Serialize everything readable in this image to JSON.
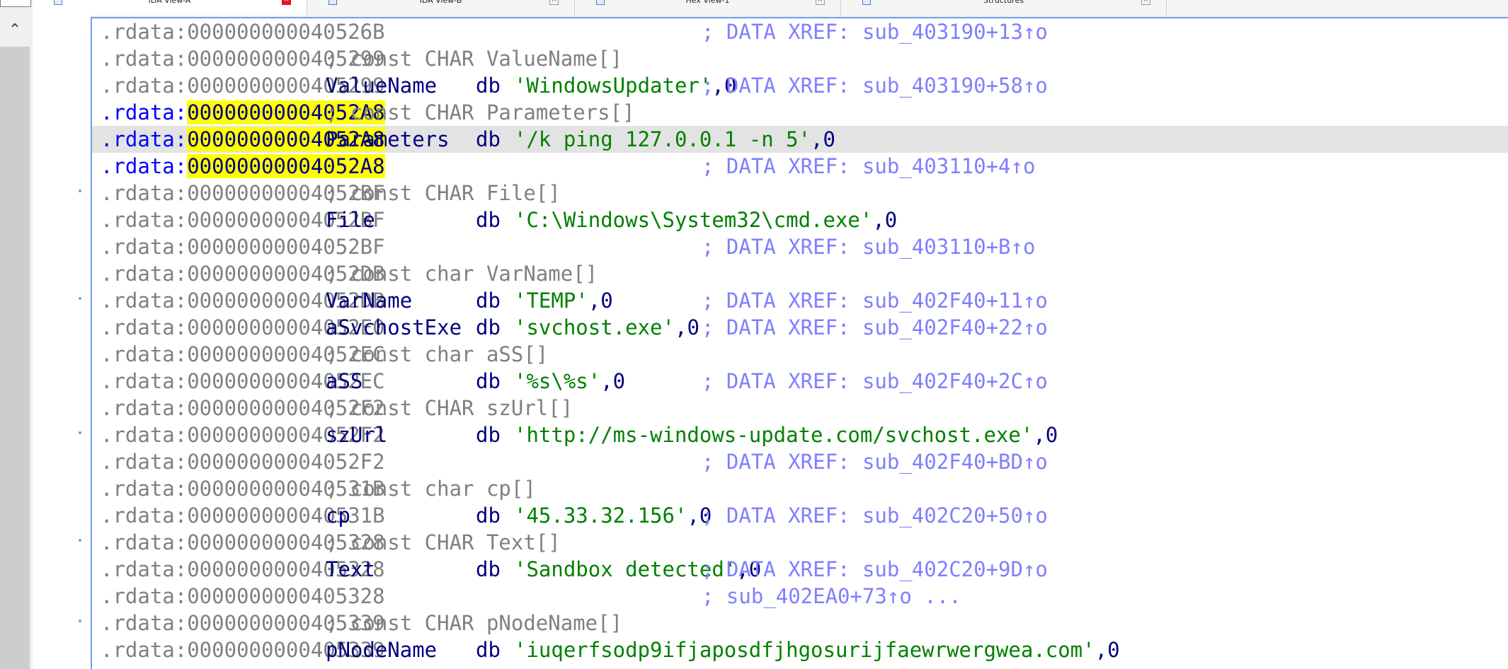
{
  "tabs": [
    {
      "label": "IDA View-A",
      "active": true,
      "icon": "ida-view-icon"
    },
    {
      "label": "IDA View-B",
      "active": false,
      "icon": "ida-view-icon"
    },
    {
      "label": "Hex View-1",
      "active": false,
      "icon": "hex-view-icon"
    },
    {
      "label": "Structures",
      "active": false,
      "icon": "structures-icon"
    }
  ],
  "close_glyph": "×",
  "scroll_up_glyph": "⌃",
  "lines": [
    {
      "seg": ".rdata:",
      "addr": "000000000040526B",
      "hl": false,
      "xref": "; DATA XREF: sub_403190+13↑o"
    },
    {
      "seg": ".rdata:",
      "addr": "0000000000405299",
      "hl": false,
      "comment": "; const CHAR ValueName[]"
    },
    {
      "seg": ".rdata:",
      "addr": "0000000000405299",
      "hl": false,
      "name": "ValueName",
      "db": "db",
      "str": "'WindowsUpdater'",
      "tail": ",0",
      "xref": "; DATA XREF: sub_403190+58↑o"
    },
    {
      "seg": ".rdata:",
      "addr": "00000000004052A8",
      "hl": true,
      "comment": "; const CHAR Parameters[]"
    },
    {
      "seg": ".rdata:",
      "addr": "00000000004052A8",
      "hl": true,
      "current": true,
      "name": "Parameters",
      "db": "db",
      "str": "'/k ping 127.0.0.1 -n 5'",
      "tail": ",0"
    },
    {
      "seg": ".rdata:",
      "addr": "00000000004052A8",
      "hl": true,
      "xref": "; DATA XREF: sub_403110+4↑o"
    },
    {
      "seg": ".rdata:",
      "addr": "00000000004052BF",
      "hl": false,
      "comment": "; const CHAR File[]"
    },
    {
      "seg": ".rdata:",
      "addr": "00000000004052BF",
      "hl": false,
      "name": "File",
      "db": "db",
      "str": "'C:\\Windows\\System32\\cmd.exe'",
      "tail": ",0"
    },
    {
      "seg": ".rdata:",
      "addr": "00000000004052BF",
      "hl": false,
      "xref": "; DATA XREF: sub_403110+B↑o"
    },
    {
      "seg": ".rdata:",
      "addr": "00000000004052DB",
      "hl": false,
      "comment": "; const char VarName[]"
    },
    {
      "seg": ".rdata:",
      "addr": "00000000004052DB",
      "hl": false,
      "name": "VarName",
      "db": "db",
      "str": "'TEMP'",
      "tail": ",0",
      "xref": "; DATA XREF: sub_402F40+11↑o"
    },
    {
      "seg": ".rdata:",
      "addr": "00000000004052E0",
      "hl": false,
      "name": "aSvchostExe",
      "db": "db",
      "str": "'svchost.exe'",
      "tail": ",0",
      "xref": "; DATA XREF: sub_402F40+22↑o"
    },
    {
      "seg": ".rdata:",
      "addr": "00000000004052EC",
      "hl": false,
      "comment": "; const char aSS[]"
    },
    {
      "seg": ".rdata:",
      "addr": "00000000004052EC",
      "hl": false,
      "name": "aSS",
      "db": "db",
      "str": "'%s\\%s'",
      "tail": ",0",
      "xref": "; DATA XREF: sub_402F40+2C↑o"
    },
    {
      "seg": ".rdata:",
      "addr": "00000000004052F2",
      "hl": false,
      "comment": "; const CHAR szUrl[]"
    },
    {
      "seg": ".rdata:",
      "addr": "00000000004052F2",
      "hl": false,
      "name": "szUrl",
      "db": "db",
      "str": "'http://ms-windows-update.com/svchost.exe'",
      "tail": ",0"
    },
    {
      "seg": ".rdata:",
      "addr": "00000000004052F2",
      "hl": false,
      "xref": "; DATA XREF: sub_402F40+BD↑o"
    },
    {
      "seg": ".rdata:",
      "addr": "000000000040531B",
      "hl": false,
      "comment": "; const char cp[]"
    },
    {
      "seg": ".rdata:",
      "addr": "000000000040531B",
      "hl": false,
      "name": "cp",
      "db": "db",
      "str": "'45.33.32.156'",
      "tail": ",0",
      "xref": "; DATA XREF: sub_402C20+50↑o"
    },
    {
      "seg": ".rdata:",
      "addr": "0000000000405328",
      "hl": false,
      "comment": "; const CHAR Text[]"
    },
    {
      "seg": ".rdata:",
      "addr": "0000000000405328",
      "hl": false,
      "name": "Text",
      "db": "db",
      "str": "'Sandbox detected'",
      "tail": ",0",
      "xref": "; DATA XREF: sub_402C20+9D↑o"
    },
    {
      "seg": ".rdata:",
      "addr": "0000000000405328",
      "hl": false,
      "xref": "; sub_402EA0+73↑o ..."
    },
    {
      "seg": ".rdata:",
      "addr": "0000000000405339",
      "hl": false,
      "comment": "; const CHAR pNodeName[]"
    },
    {
      "seg": ".rdata:",
      "addr": "0000000000405339",
      "hl": false,
      "name": "pNodeName",
      "db": "db",
      "str": "'iuqerfsodp9ifjaposdfjhgosurijfaewrwergwea.com'",
      "tail": ",0"
    }
  ],
  "colors": {
    "segment_selected": "#0000ff",
    "address": "#808080",
    "address_highlight_bg": "#ffff00",
    "name": "#000080",
    "string": "#008000",
    "xref": "#7f7fff",
    "current_line_bg": "#e3e3e3",
    "pane_border": "#6fa0e8"
  }
}
